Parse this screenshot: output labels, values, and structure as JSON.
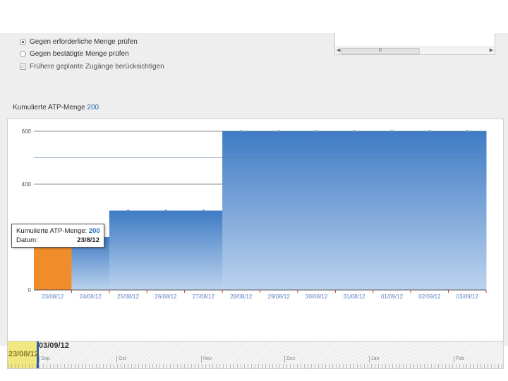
{
  "options": {
    "radio_required": "Gegen erforderliche Menge prüfen",
    "radio_confirmed": "Gegen bestätigte Menge prüfen",
    "check_earlier": "Frühere geplante Zugänge berücksichtigen"
  },
  "listbox": {
    "thumb_glyph": "III"
  },
  "summary": {
    "label": "Kumulierte ATP-Menge",
    "value": "200"
  },
  "colors": {
    "series_fill_top": "#3f7bc4",
    "series_fill_bottom": "#bcd3ee",
    "highlight_bar": "#f08c2a",
    "accent_text": "#2a6ab8"
  },
  "chart_data": {
    "type": "area",
    "categories": [
      "23/08/12",
      "24/08/12",
      "25/08/12",
      "26/08/12",
      "27/08/12",
      "28/08/12",
      "29/08/12",
      "30/08/12",
      "31/08/12",
      "01/09/12",
      "02/09/12",
      "03/09/12"
    ],
    "series": [
      {
        "values": [
          200,
          200,
          300,
          300,
          300,
          600,
          600,
          600,
          600,
          600,
          600,
          600
        ]
      }
    ],
    "highlighted_category": "23/08/12",
    "step": true,
    "yticks": [
      0,
      400,
      600
    ],
    "ylim": [
      0,
      600
    ],
    "grid": true
  },
  "tooltip": {
    "label": "Kumulierte ATP-Menge:",
    "value": "200",
    "date_label": "Datum:",
    "date_value": "23/8/12"
  },
  "navigator": {
    "start": "23/08/12",
    "end": "03/09/12",
    "months": [
      "Sep",
      "Oct",
      "Nov",
      "Dec",
      "Jan",
      "Feb"
    ]
  }
}
